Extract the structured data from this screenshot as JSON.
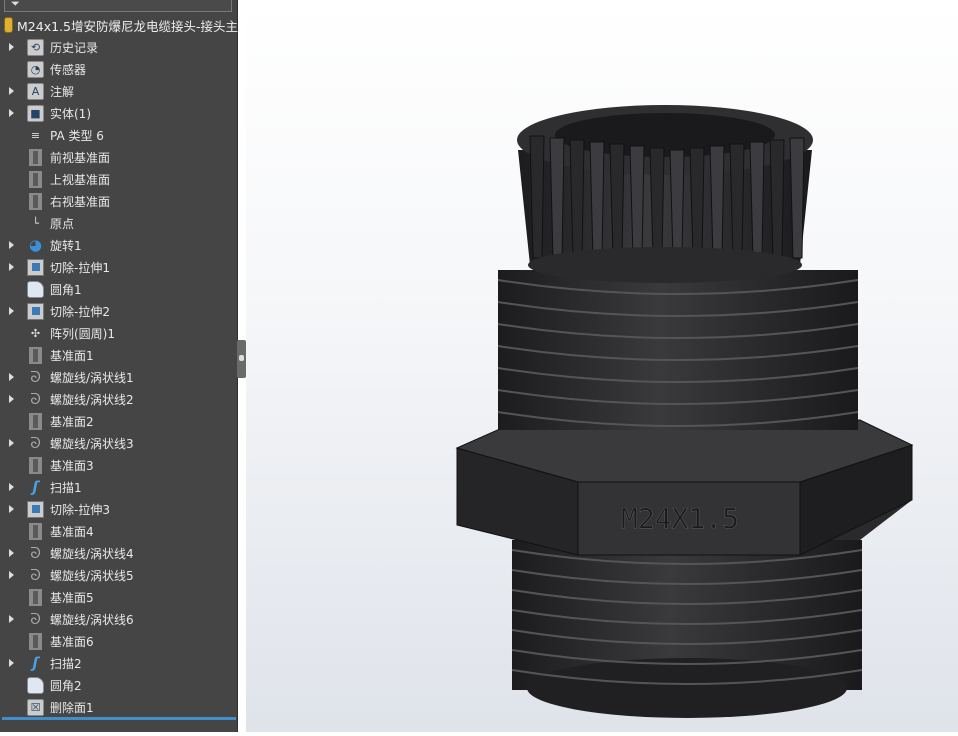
{
  "tree": {
    "filter_icon": "filter-icon",
    "root_label": "M24x1.5增安防爆尼龙电缆接头-接头主",
    "items": [
      {
        "label": "历史记录",
        "expandable": true,
        "icon": "history-folder-icon"
      },
      {
        "label": "传感器",
        "expandable": false,
        "icon": "sensor-folder-icon"
      },
      {
        "label": "注解",
        "expandable": true,
        "icon": "annotation-folder-icon"
      },
      {
        "label": "实体(1)",
        "expandable": true,
        "icon": "solid-bodies-folder-icon"
      },
      {
        "label": "PA 类型 6",
        "expandable": false,
        "icon": "material-icon"
      },
      {
        "label": "前视基准面",
        "expandable": false,
        "icon": "plane-icon"
      },
      {
        "label": "上视基准面",
        "expandable": false,
        "icon": "plane-icon"
      },
      {
        "label": "右视基准面",
        "expandable": false,
        "icon": "plane-icon"
      },
      {
        "label": "原点",
        "expandable": false,
        "icon": "origin-icon"
      },
      {
        "label": "旋转1",
        "expandable": true,
        "icon": "revolve-icon"
      },
      {
        "label": "切除-拉伸1",
        "expandable": true,
        "icon": "cut-extrude-icon"
      },
      {
        "label": "圆角1",
        "expandable": false,
        "icon": "fillet-icon"
      },
      {
        "label": "切除-拉伸2",
        "expandable": true,
        "icon": "cut-extrude-icon"
      },
      {
        "label": "阵列(圆周)1",
        "expandable": false,
        "icon": "circular-pattern-icon"
      },
      {
        "label": "基准面1",
        "expandable": false,
        "icon": "plane-icon"
      },
      {
        "label": "螺旋线/涡状线1",
        "expandable": true,
        "icon": "helix-icon"
      },
      {
        "label": "螺旋线/涡状线2",
        "expandable": true,
        "icon": "helix-icon"
      },
      {
        "label": "基准面2",
        "expandable": false,
        "icon": "plane-icon"
      },
      {
        "label": "螺旋线/涡状线3",
        "expandable": true,
        "icon": "helix-icon"
      },
      {
        "label": "基准面3",
        "expandable": false,
        "icon": "plane-icon"
      },
      {
        "label": "扫描1",
        "expandable": true,
        "icon": "sweep-icon"
      },
      {
        "label": "切除-拉伸3",
        "expandable": true,
        "icon": "cut-extrude-icon"
      },
      {
        "label": "基准面4",
        "expandable": false,
        "icon": "plane-icon"
      },
      {
        "label": "螺旋线/涡状线4",
        "expandable": true,
        "icon": "helix-icon"
      },
      {
        "label": "螺旋线/涡状线5",
        "expandable": true,
        "icon": "helix-icon"
      },
      {
        "label": "基准面5",
        "expandable": false,
        "icon": "plane-icon"
      },
      {
        "label": "螺旋线/涡状线6",
        "expandable": true,
        "icon": "helix-icon"
      },
      {
        "label": "基准面6",
        "expandable": false,
        "icon": "plane-icon"
      },
      {
        "label": "扫描2",
        "expandable": true,
        "icon": "sweep-icon"
      },
      {
        "label": "圆角2",
        "expandable": false,
        "icon": "fillet-icon"
      },
      {
        "label": "删除面1",
        "expandable": false,
        "icon": "delete-face-icon"
      }
    ]
  },
  "model": {
    "engraving": "M24X1.5",
    "body_color": "#2b2b2d"
  }
}
